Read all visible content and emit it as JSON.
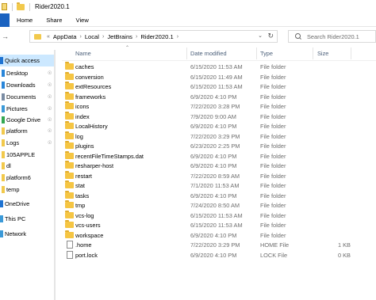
{
  "window": {
    "title": "Rider2020.1"
  },
  "ribbon": {
    "tabs": [
      "Home",
      "Share",
      "View"
    ]
  },
  "address": {
    "crumbs": [
      "AppData",
      "Local",
      "JetBrains",
      "Rider2020.1"
    ],
    "overflow": "«"
  },
  "search": {
    "placeholder": "Search Rider2020.1"
  },
  "columns": {
    "name": "Name",
    "date": "Date modified",
    "type": "Type",
    "size": "Size"
  },
  "nav": [
    {
      "label": "Quick access",
      "icon": "star-icon",
      "pinned": false,
      "selected": true,
      "color": "#1e73d2"
    },
    {
      "label": "Desktop",
      "icon": "desktop-icon",
      "pinned": true,
      "color": "#2a86d9"
    },
    {
      "label": "Downloads",
      "icon": "download-icon",
      "pinned": true,
      "color": "#2a86d9"
    },
    {
      "label": "Documents",
      "icon": "documents-icon",
      "pinned": true,
      "color": "#7a8ca3"
    },
    {
      "label": "Pictures",
      "icon": "pictures-icon",
      "pinned": true,
      "color": "#3c9ad8"
    },
    {
      "label": "Google Drive",
      "icon": "google-drive-icon",
      "pinned": true,
      "color": "#35a853"
    },
    {
      "label": "platform",
      "icon": "folder-icon",
      "pinned": true,
      "color": "#f2c94c"
    },
    {
      "label": "Logs",
      "icon": "folder-icon",
      "pinned": true,
      "color": "#f2c94c"
    },
    {
      "label": "105APPLE",
      "icon": "folder-icon",
      "pinned": false,
      "color": "#f2c94c"
    },
    {
      "label": "dl",
      "icon": "folder-icon",
      "pinned": false,
      "color": "#f2c94c"
    },
    {
      "label": "platform6",
      "icon": "folder-icon",
      "pinned": false,
      "color": "#f2c94c"
    },
    {
      "label": "temp",
      "icon": "folder-icon",
      "pinned": false,
      "color": "#f2c94c"
    },
    {
      "label": "OneDrive",
      "icon": "onedrive-icon",
      "pinned": false,
      "color": "#1e73d2"
    },
    {
      "label": "This PC",
      "icon": "computer-icon",
      "pinned": false,
      "color": "#3c9ad8"
    },
    {
      "label": "Network",
      "icon": "network-icon",
      "pinned": false,
      "color": "#3c9ad8"
    }
  ],
  "files": [
    {
      "name": "caches",
      "date": "6/15/2020 11:53 AM",
      "type": "File folder",
      "size": "",
      "kind": "folder"
    },
    {
      "name": "conversion",
      "date": "6/15/2020 11:49 AM",
      "type": "File folder",
      "size": "",
      "kind": "folder"
    },
    {
      "name": "extResources",
      "date": "6/15/2020 11:53 AM",
      "type": "File folder",
      "size": "",
      "kind": "folder"
    },
    {
      "name": "frameworks",
      "date": "6/9/2020 4:10 PM",
      "type": "File folder",
      "size": "",
      "kind": "folder"
    },
    {
      "name": "icons",
      "date": "7/22/2020 3:28 PM",
      "type": "File folder",
      "size": "",
      "kind": "folder"
    },
    {
      "name": "index",
      "date": "7/9/2020 9:00 AM",
      "type": "File folder",
      "size": "",
      "kind": "folder"
    },
    {
      "name": "LocalHistory",
      "date": "6/9/2020 4:10 PM",
      "type": "File folder",
      "size": "",
      "kind": "folder"
    },
    {
      "name": "log",
      "date": "7/22/2020 3:29 PM",
      "type": "File folder",
      "size": "",
      "kind": "folder"
    },
    {
      "name": "plugins",
      "date": "6/23/2020 2:25 PM",
      "type": "File folder",
      "size": "",
      "kind": "folder"
    },
    {
      "name": "recentFileTimeStamps.dat",
      "date": "6/9/2020 4:10 PM",
      "type": "File folder",
      "size": "",
      "kind": "folder"
    },
    {
      "name": "resharper-host",
      "date": "6/9/2020 4:10 PM",
      "type": "File folder",
      "size": "",
      "kind": "folder"
    },
    {
      "name": "restart",
      "date": "7/22/2020 8:59 AM",
      "type": "File folder",
      "size": "",
      "kind": "folder"
    },
    {
      "name": "stat",
      "date": "7/1/2020 11:53 AM",
      "type": "File folder",
      "size": "",
      "kind": "folder"
    },
    {
      "name": "tasks",
      "date": "6/9/2020 4:10 PM",
      "type": "File folder",
      "size": "",
      "kind": "folder"
    },
    {
      "name": "tmp",
      "date": "7/24/2020 8:50 AM",
      "type": "File folder",
      "size": "",
      "kind": "folder"
    },
    {
      "name": "vcs-log",
      "date": "6/15/2020 11:53 AM",
      "type": "File folder",
      "size": "",
      "kind": "folder"
    },
    {
      "name": "vcs-users",
      "date": "6/15/2020 11:53 AM",
      "type": "File folder",
      "size": "",
      "kind": "folder"
    },
    {
      "name": "workspace",
      "date": "6/9/2020 4:10 PM",
      "type": "File folder",
      "size": "",
      "kind": "folder"
    },
    {
      "name": ".home",
      "date": "7/22/2020 3:29 PM",
      "type": "HOME File",
      "size": "1 KB",
      "kind": "file"
    },
    {
      "name": "port.lock",
      "date": "6/9/2020 4:10 PM",
      "type": "LOCK File",
      "size": "0 KB",
      "kind": "file"
    }
  ]
}
